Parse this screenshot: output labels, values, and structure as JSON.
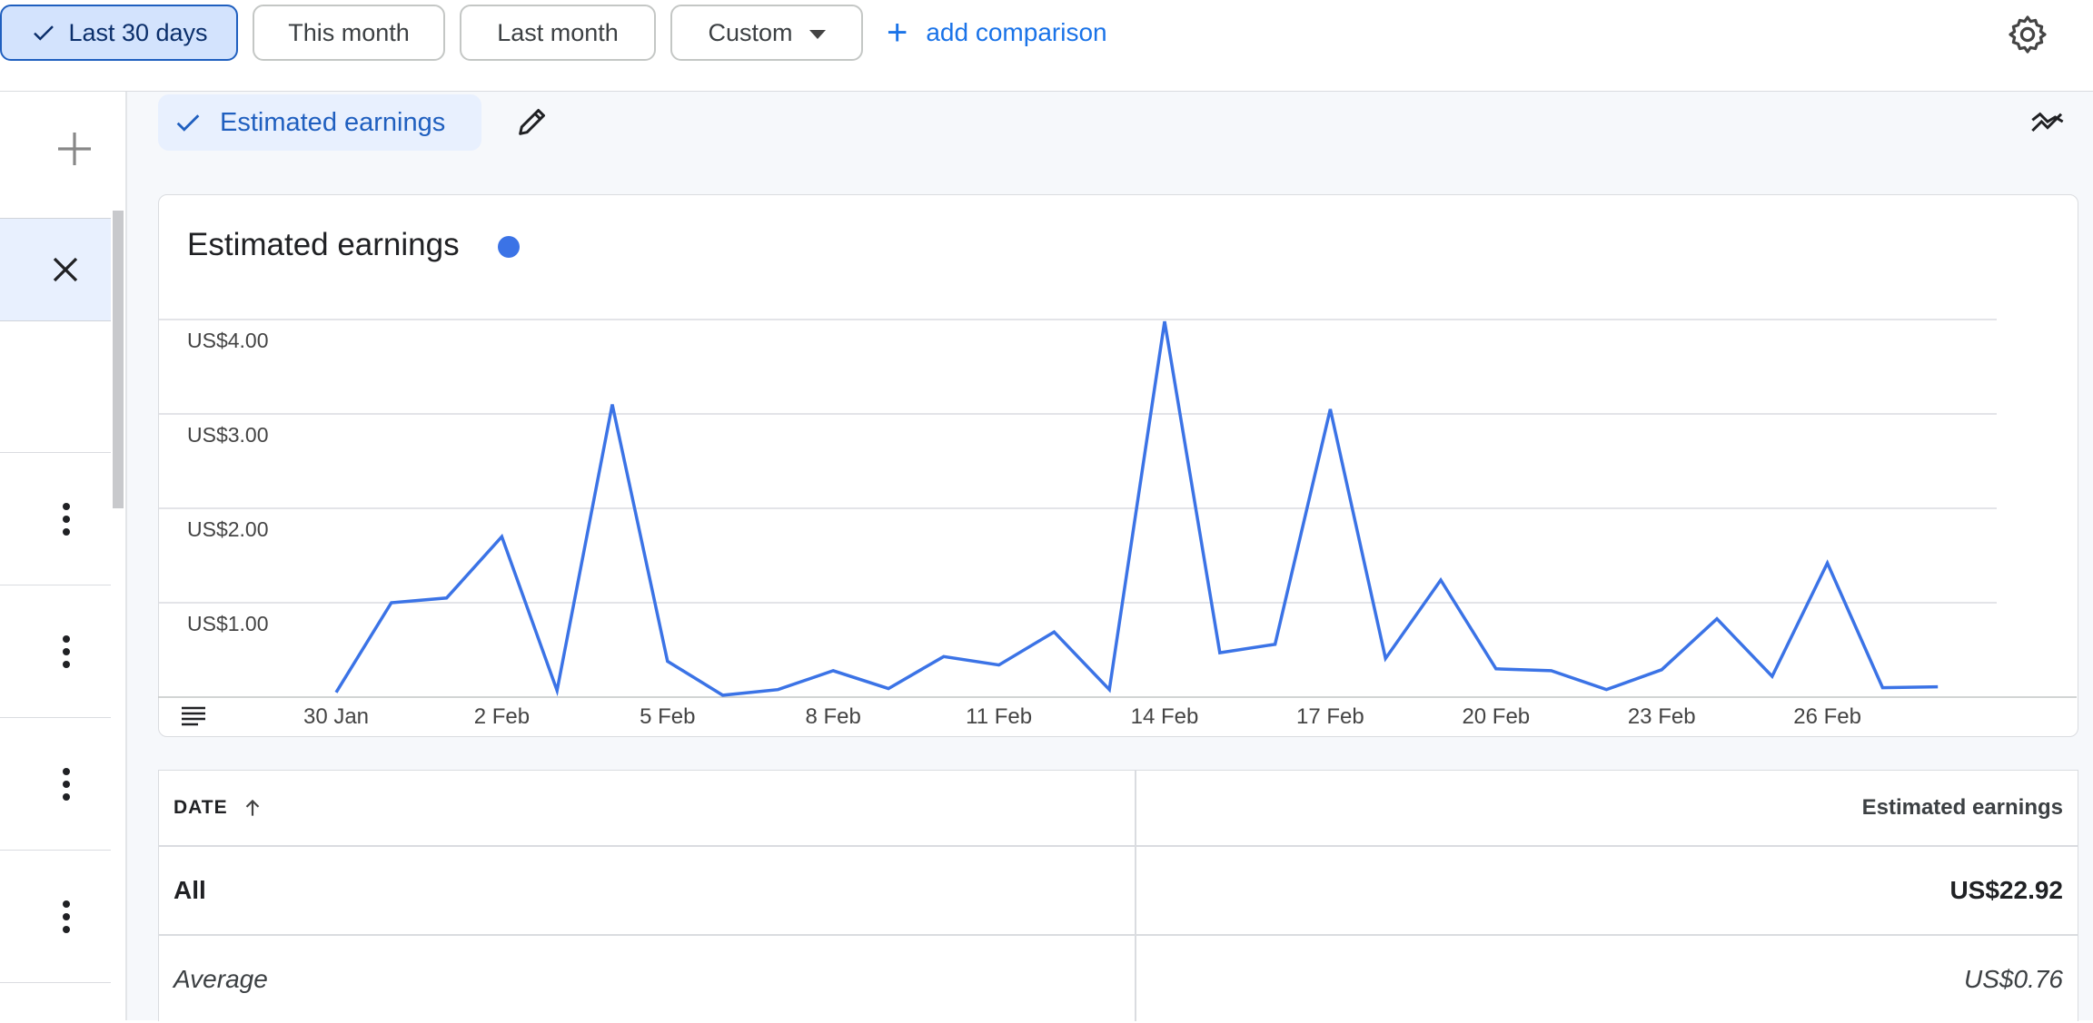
{
  "toolbar": {
    "date_ranges": [
      "Last 30 days",
      "This month",
      "Last month"
    ],
    "custom_label": "Custom",
    "add_comparison_label": "add comparison"
  },
  "metric": {
    "chip_label": "Estimated earnings"
  },
  "chart_data": {
    "type": "line",
    "title": "Estimated earnings",
    "color": "#3b73e6",
    "y_tick_labels": [
      "US$4.00",
      "US$3.00",
      "US$2.00",
      "US$1.00"
    ],
    "ylim": [
      0,
      4
    ],
    "x_tick_labels": [
      "30 Jan",
      "2 Feb",
      "5 Feb",
      "8 Feb",
      "11 Feb",
      "14 Feb",
      "17 Feb",
      "20 Feb",
      "23 Feb",
      "26 Feb"
    ],
    "x": [
      "30 Jan",
      "31 Jan",
      "1 Feb",
      "2 Feb",
      "3 Feb",
      "4 Feb",
      "5 Feb",
      "6 Feb",
      "7 Feb",
      "8 Feb",
      "9 Feb",
      "10 Feb",
      "11 Feb",
      "12 Feb",
      "13 Feb",
      "14 Feb",
      "15 Feb",
      "16 Feb",
      "17 Feb",
      "18 Feb",
      "19 Feb",
      "20 Feb",
      "21 Feb",
      "22 Feb",
      "23 Feb",
      "24 Feb",
      "25 Feb",
      "26 Feb",
      "27 Feb",
      "28 Feb"
    ],
    "values": [
      0.05,
      1.0,
      1.05,
      1.7,
      0.07,
      3.1,
      0.38,
      0.02,
      0.08,
      0.28,
      0.09,
      0.43,
      0.34,
      0.69,
      0.08,
      3.98,
      0.47,
      0.56,
      3.05,
      0.41,
      1.24,
      0.3,
      0.28,
      0.08,
      0.29,
      0.83,
      0.22,
      1.42,
      0.1,
      0.11
    ],
    "grid": true
  },
  "table": {
    "col_date": "DATE",
    "col_earnings": "Estimated earnings",
    "rows": [
      {
        "label": "All",
        "value": "US$22.92"
      },
      {
        "label": "Average",
        "value": "US$0.76"
      }
    ]
  }
}
